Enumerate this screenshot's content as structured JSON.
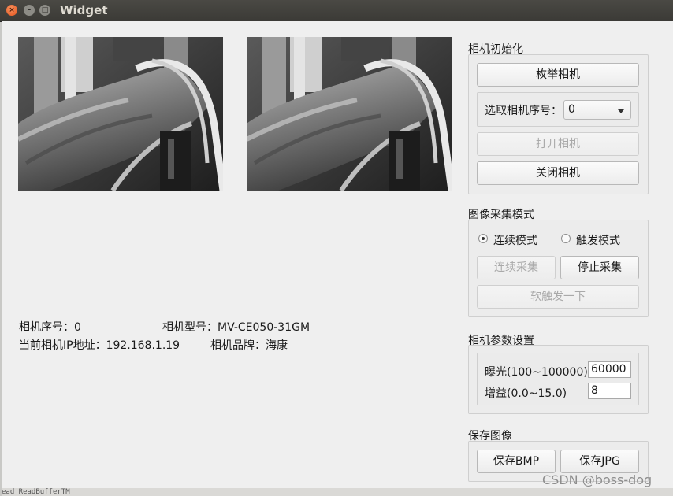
{
  "window": {
    "title": "Widget"
  },
  "titlebar_buttons": {
    "close": "×",
    "min": "–",
    "max": "□"
  },
  "info": {
    "cam_index": "相机序号：0",
    "cam_model": "相机型号：MV-CE050-31GM",
    "cam_ip": "当前相机IP地址：192.168.1.19",
    "cam_brand": "相机品牌：海康"
  },
  "init_group": {
    "title": "相机初始化",
    "enum_button": "枚举相机",
    "select_label": "选取相机序号：",
    "select_value": "0",
    "open_button": "打开相机",
    "close_button": "关闭相机"
  },
  "capture_group": {
    "title": "图像采集模式",
    "radio_continuous": "连续模式",
    "radio_trigger": "触发模式",
    "continuous_button": "连续采集",
    "stop_button": "停止采集",
    "soft_trigger_button": "软触发一下"
  },
  "params_group": {
    "title": "相机参数设置",
    "exposure_label": "曝光(100~100000)",
    "exposure_value": "60000",
    "gain_label": "增益(0.0~15.0)",
    "gain_value": "8"
  },
  "save_group": {
    "title": "保存图像",
    "bmp_button": "保存BMP",
    "jpg_button": "保存JPG"
  },
  "watermark": "CSDN @boss-dog",
  "background_text": "ead ReadBufferTM"
}
